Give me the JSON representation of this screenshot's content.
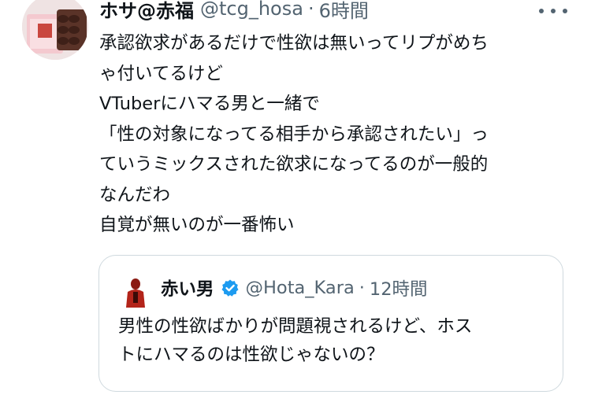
{
  "tweet": {
    "author_name": "ホサ@赤福",
    "author_handle": "@tcg_hosa",
    "separator": "·",
    "time": "6時間",
    "avatar_icon": "akafuku-box-avatar-icon",
    "more_icon": "more-dots-icon",
    "lines": [
      "承認欲求があるだけで性欲は無いってリプがめち",
      "ゃ付いてるけど",
      "VTuberにハマる男と一緒で",
      "「性の対象になってる相手から承認されたい」っ",
      "ていうミックスされた欲求になってるのが一般的",
      "なんだわ",
      "自覚が無いのが一番怖い"
    ]
  },
  "quote": {
    "author_name": "赤い男",
    "verified_icon": "verified-badge-icon",
    "author_handle": "@Hota_Kara",
    "separator": "·",
    "time": "12時間",
    "avatar_icon": "red-figure-avatar-icon",
    "lines": [
      "男性の性欲ばかりが問題視されるけど、ホス",
      "トにハマるのは性欲じゃないの？"
    ]
  },
  "colors": {
    "text": "#0f1419",
    "secondary": "#536471",
    "border": "#cfd9de",
    "verified": "#1d9bf0"
  }
}
